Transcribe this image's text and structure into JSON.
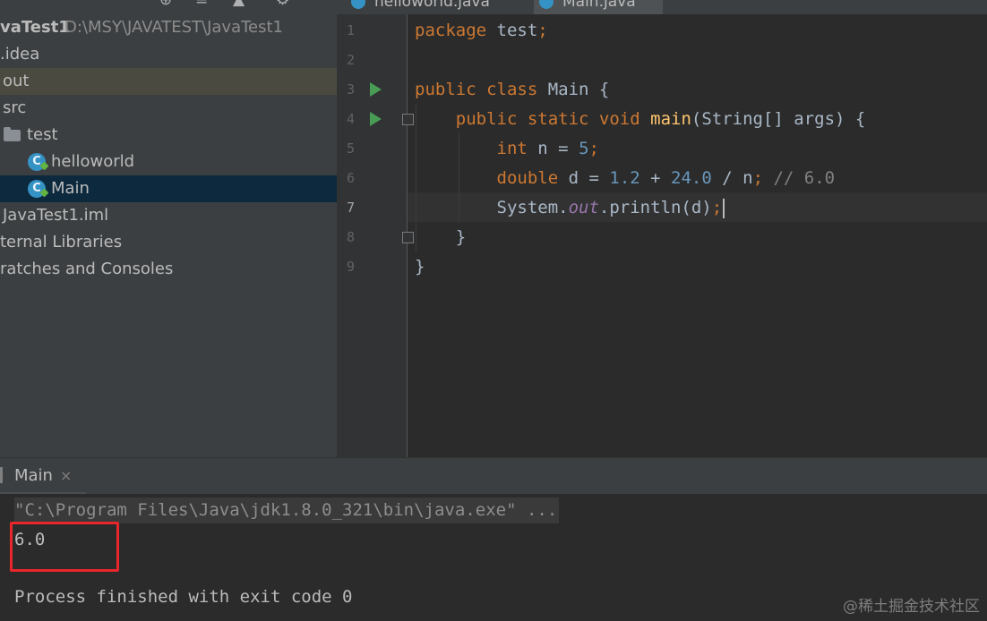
{
  "project": {
    "root_name": "vaTest1",
    "root_path": "D:\\MSY\\JAVATEST\\JavaTest1",
    "items": [
      {
        "label": ".idea"
      },
      {
        "label": "out"
      },
      {
        "label": "src"
      },
      {
        "label": "test"
      },
      {
        "label": "helloworld"
      },
      {
        "label": "Main"
      },
      {
        "label": "JavaTest1.iml"
      },
      {
        "label": "ternal Libraries"
      },
      {
        "label": "ratches and Consoles"
      }
    ]
  },
  "tabs": [
    {
      "label": "helloworld.java"
    },
    {
      "label": "Main.java"
    }
  ],
  "editor": {
    "line_numbers": [
      "1",
      "2",
      "3",
      "4",
      "5",
      "6",
      "7",
      "8",
      "9"
    ],
    "current_line": "7",
    "lines": {
      "l1": {
        "kw": "package",
        "name": "test",
        "semi": ";"
      },
      "l3": {
        "kw": "public class",
        "name": "Main {"
      },
      "l4": {
        "kw": "public static void",
        "fn": "main",
        "rest": "(String[] args) {"
      },
      "l5": {
        "kw": "int",
        "rest": "n = ",
        "num": "5",
        "semi": ";"
      },
      "l6": {
        "kw": "double",
        "rest": "d = ",
        "num1": "1.2",
        "op": " + ",
        "num2": "24.0",
        "rest2": " / n",
        "semi": ";",
        "comment": "// 6.0"
      },
      "l7": {
        "pre": "System.",
        "field": "out",
        "post": ".println(d)",
        "semi": ";"
      },
      "l8": {
        "text": "}"
      },
      "l9": {
        "text": "}"
      }
    }
  },
  "run": {
    "tab_label": "Main",
    "tab_close": "×",
    "command": "\"C:\\Program Files\\Java\\jdk1.8.0_321\\bin\\java.exe\" ...",
    "output": "6.0",
    "exit_message": "Process finished with exit code 0"
  },
  "watermark": "@稀土掘金技术社区",
  "colors": {
    "keyword": "#cc7832",
    "function": "#ffc66d",
    "number": "#6897bb",
    "comment": "#808080",
    "static_field": "#9876aa",
    "highlight_box": "#e8262b",
    "run_gutter": "#499c54"
  }
}
